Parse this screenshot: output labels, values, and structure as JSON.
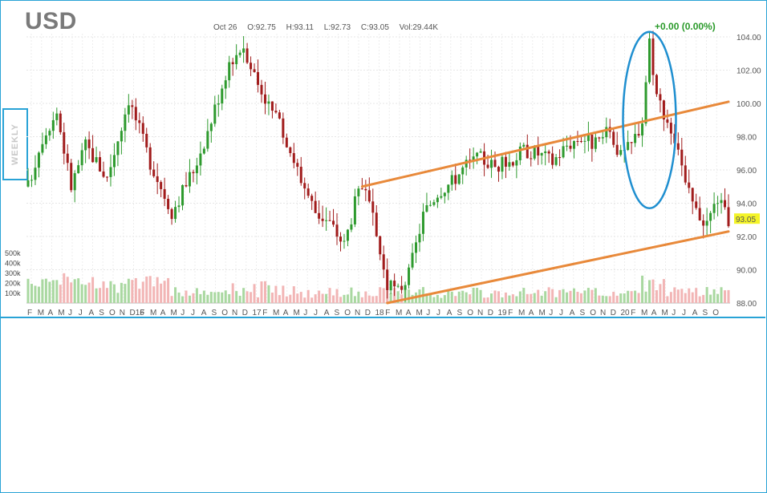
{
  "header": {
    "symbol": "USD",
    "date": "Oct 26",
    "open": "O:92.75",
    "high": "H:93.11",
    "low": "L:92.73",
    "close": "C:93.05",
    "volume": "Vol:29.44K",
    "change": "+0.00 (0.00%)"
  },
  "sidebar": {
    "period_label": "WEEKLY"
  },
  "colors": {
    "up": "#2e9a2e",
    "down": "#a11c1c",
    "vol_up": "#a9d8a0",
    "vol_down": "#f2b5b5",
    "trendline": "#e8893a",
    "circle": "#1f8fd0",
    "frame": "#29a3d6",
    "last_price_bg": "#f4f427"
  },
  "chart_data": {
    "type": "candlestick",
    "price_axis": {
      "min": 88,
      "max": 104,
      "ticks": [
        "104.00",
        "102.00",
        "100.00",
        "98.00",
        "96.00",
        "94.00",
        "92.00",
        "90.00",
        "88.00"
      ]
    },
    "volume_axis": {
      "ticks": [
        "500k",
        "400k",
        "300k",
        "200k",
        "100k"
      ]
    },
    "x_labels": [
      "F",
      "M",
      "A",
      "M",
      "J",
      "J",
      "A",
      "S",
      "O",
      "N",
      "D16",
      "F",
      "M",
      "A",
      "M",
      "J",
      "J",
      "A",
      "S",
      "O",
      "N",
      "D",
      "17",
      "F",
      "M",
      "A",
      "M",
      "J",
      "J",
      "A",
      "S",
      "O",
      "N",
      "D",
      "18",
      "F",
      "M",
      "A",
      "M",
      "J",
      "J",
      "A",
      "S",
      "O",
      "N",
      "D",
      "19",
      "F",
      "M",
      "A",
      "M",
      "J",
      "J",
      "A",
      "S",
      "O",
      "N",
      "D",
      "20",
      "F",
      "M",
      "A",
      "M",
      "J",
      "J",
      "A",
      "S",
      "O"
    ],
    "last_price": "93.05",
    "price_path": [
      [
        0,
        95.0
      ],
      [
        4,
        98.0
      ],
      [
        8,
        99.5
      ],
      [
        12,
        95.0
      ],
      [
        16,
        97.5
      ],
      [
        22,
        95.5
      ],
      [
        28,
        100.3
      ],
      [
        34,
        96.5
      ],
      [
        40,
        93.5
      ],
      [
        46,
        96.0
      ],
      [
        50,
        98.3
      ],
      [
        56,
        102.5
      ],
      [
        60,
        103.5
      ],
      [
        64,
        101.2
      ],
      [
        68,
        99.5
      ],
      [
        72,
        97.8
      ],
      [
        76,
        95.5
      ],
      [
        80,
        93.5
      ],
      [
        84,
        92.8
      ],
      [
        88,
        91.5
      ],
      [
        91,
        94.0
      ],
      [
        93,
        95.0
      ],
      [
        96,
        93.0
      ],
      [
        98,
        91.0
      ],
      [
        100,
        89.0
      ],
      [
        103,
        88.7
      ],
      [
        106,
        89.7
      ],
      [
        110,
        93.3
      ],
      [
        114,
        94.7
      ],
      [
        118,
        95.3
      ],
      [
        122,
        96.3
      ],
      [
        126,
        96.7
      ],
      [
        130,
        96.2
      ],
      [
        134,
        96.5
      ],
      [
        138,
        97.2
      ],
      [
        142,
        97.0
      ],
      [
        146,
        96.5
      ],
      [
        150,
        97.5
      ],
      [
        154,
        98.0
      ],
      [
        158,
        97.5
      ],
      [
        162,
        98.3
      ],
      [
        165,
        96.8
      ],
      [
        168,
        97.5
      ],
      [
        171,
        99.0
      ],
      [
        173,
        103.8
      ],
      [
        175,
        100.5
      ],
      [
        177,
        99.5
      ],
      [
        179,
        98.5
      ],
      [
        181,
        97.5
      ],
      [
        183,
        95.0
      ],
      [
        186,
        93.5
      ],
      [
        189,
        92.8
      ],
      [
        192,
        94.3
      ],
      [
        194,
        93.3
      ],
      [
        195,
        93.05
      ]
    ],
    "trendlines": [
      {
        "name": "upper",
        "from": [
          93,
          95.0
        ],
        "to": [
          195,
          100.1
        ]
      },
      {
        "name": "lower",
        "from": [
          100,
          88.0
        ],
        "to": [
          195,
          92.3
        ]
      }
    ],
    "highlight": {
      "shape": "ellipse",
      "center": [
        173,
        99.0
      ],
      "note": ""
    }
  }
}
